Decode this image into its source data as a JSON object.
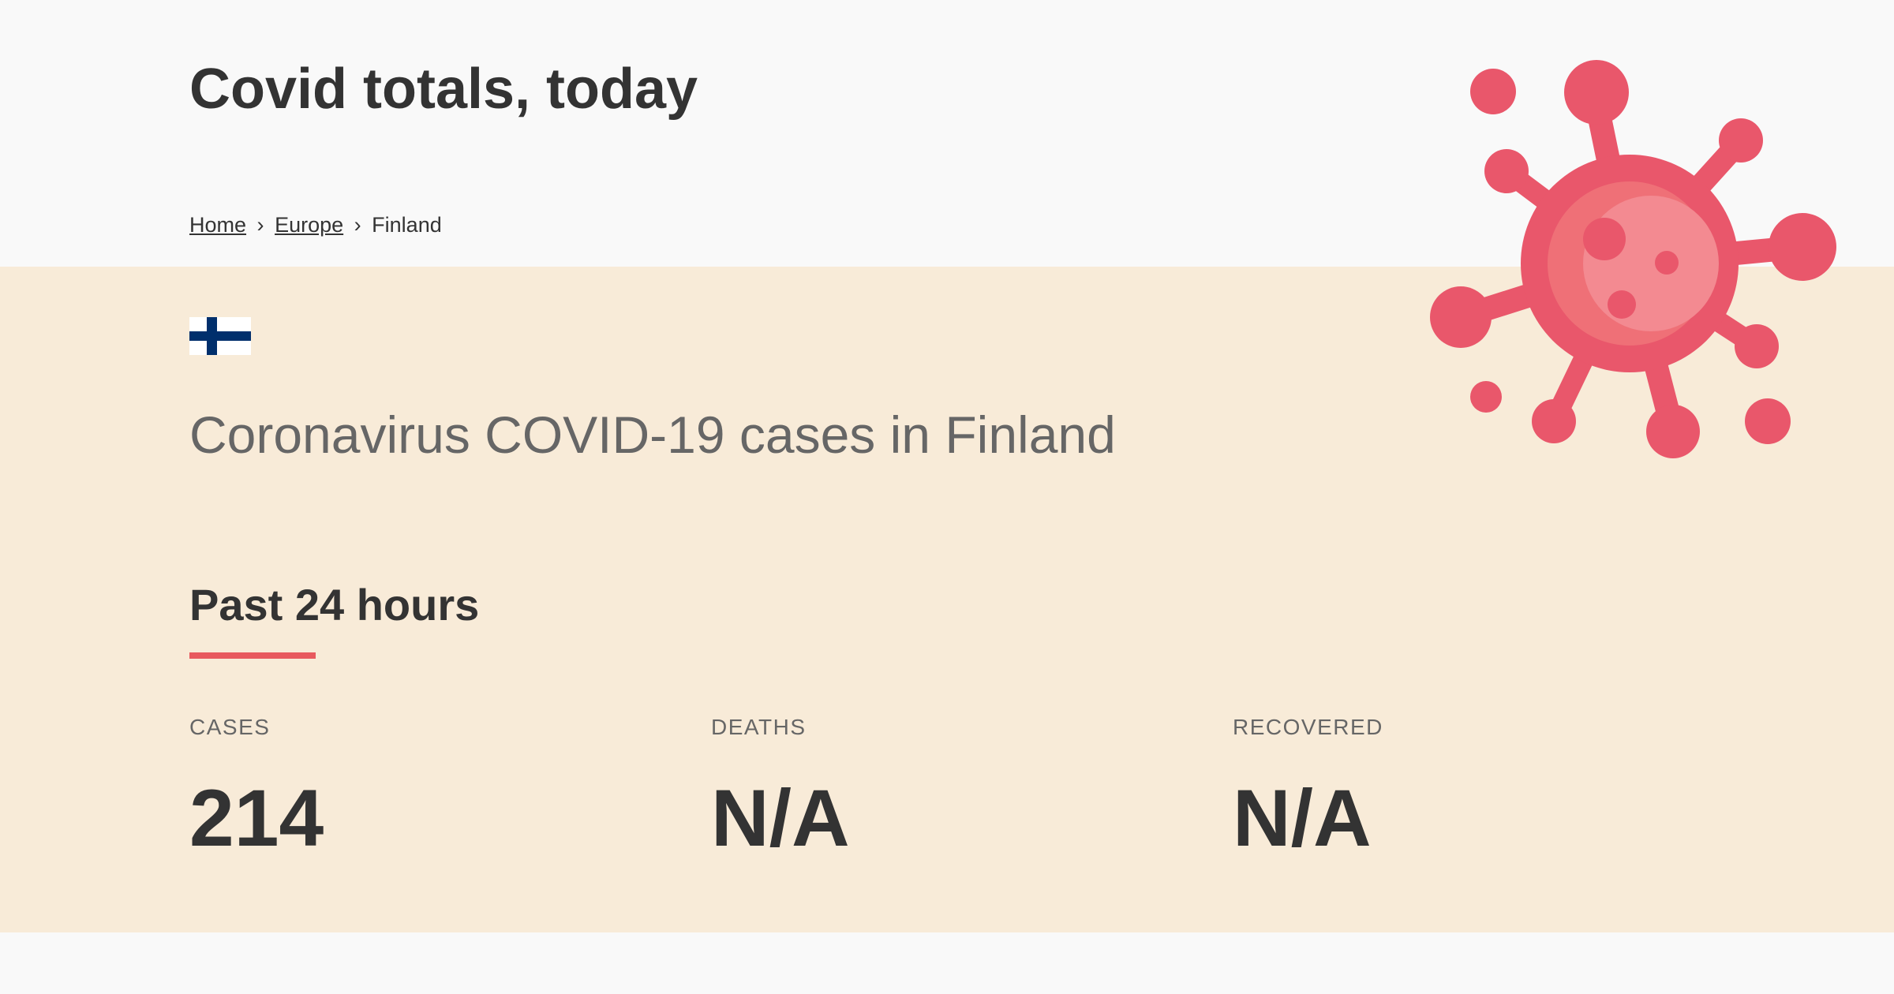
{
  "header": {
    "title": "Covid totals, today",
    "breadcrumb": {
      "home": "Home",
      "separator": "›",
      "region": "Europe",
      "current": "Finland"
    }
  },
  "country": {
    "flag_icon": "finland-flag-icon",
    "title": "Coronavirus COVID-19 cases in Finland"
  },
  "section": {
    "title": "Past 24 hours",
    "accent_color": "#e8595e"
  },
  "stats": {
    "cases": {
      "label": "CASES",
      "value": "214"
    },
    "deaths": {
      "label": "DEATHS",
      "value": "N/A"
    },
    "recovered": {
      "label": "RECOVERED",
      "value": "N/A"
    }
  },
  "illustration": {
    "icon": "coronavirus-icon",
    "color": "#e9576b"
  }
}
